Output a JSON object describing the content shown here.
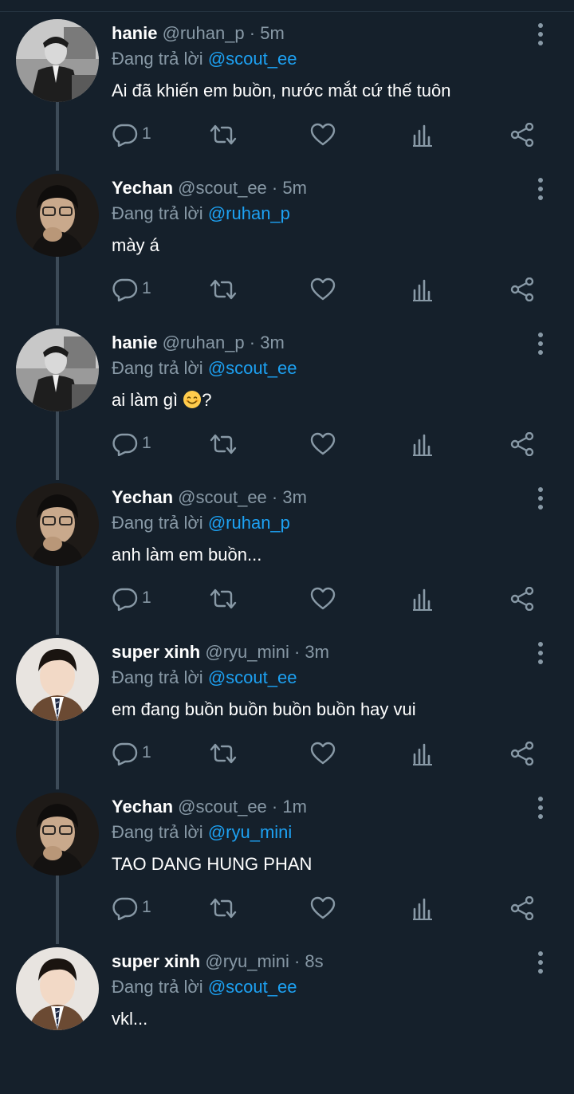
{
  "colors": {
    "background": "#15202b",
    "secondary_text": "#8899a6",
    "accent": "#1da1f2",
    "primary_text": "#ffffff"
  },
  "icons": [
    "more-icon",
    "reply-icon",
    "retweet-icon",
    "like-icon",
    "analytics-icon",
    "share-icon"
  ],
  "tweets": [
    {
      "name": "hanie",
      "handle": "@ruhan_p",
      "dot": "·",
      "time": "5m",
      "replying_prefix": "Đang trả lời",
      "replying_to": "@scout_ee",
      "text": "Ai đã khiến em buồn, nước mắt cứ thế tuôn",
      "reply_count": "1",
      "avatar": "hanie"
    },
    {
      "name": "Yechan",
      "handle": "@scout_ee",
      "dot": "·",
      "time": "5m",
      "replying_prefix": "Đang trả lời",
      "replying_to": "@ruhan_p",
      "text": "mày á",
      "reply_count": "1",
      "avatar": "yechan"
    },
    {
      "name": "hanie",
      "handle": "@ruhan_p",
      "dot": "·",
      "time": "3m",
      "replying_prefix": "Đang trả lời",
      "replying_to": "@scout_ee",
      "text": "ai làm gì",
      "text_suffix": "?",
      "emoji": "smiling-face-emoji",
      "reply_count": "1",
      "avatar": "hanie"
    },
    {
      "name": "Yechan",
      "handle": "@scout_ee",
      "dot": "·",
      "time": "3m",
      "replying_prefix": "Đang trả lời",
      "replying_to": "@ruhan_p",
      "text": "anh làm em buồn...",
      "reply_count": "1",
      "avatar": "yechan"
    },
    {
      "name": "super xinh",
      "handle": "@ryu_mini",
      "dot": "·",
      "time": "3m",
      "replying_prefix": "Đang trả lời",
      "replying_to": "@scout_ee",
      "text": "em đang buồn buồn buồn buồn hay vui",
      "reply_count": "1",
      "avatar": "superxinh"
    },
    {
      "name": "Yechan",
      "handle": "@scout_ee",
      "dot": "·",
      "time": "1m",
      "replying_prefix": "Đang trả lời",
      "replying_to": "@ryu_mini",
      "text": "TAO DANG HUNG PHAN",
      "reply_count": "1",
      "avatar": "yechan"
    },
    {
      "name": "super xinh",
      "handle": "@ryu_mini",
      "dot": "·",
      "time": "8s",
      "replying_prefix": "Đang trả lời",
      "replying_to": "@scout_ee",
      "text": "vkl...",
      "avatar": "superxinh"
    }
  ]
}
